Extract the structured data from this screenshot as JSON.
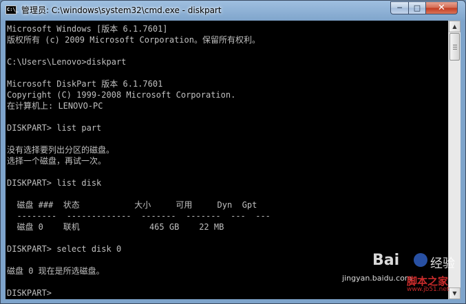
{
  "window": {
    "title": "管理员: C:\\windows\\system32\\cmd.exe - diskpart",
    "app_icon_text": "C:\\_",
    "controls": {
      "minimize": "─",
      "maximize": "□",
      "close": "✕"
    }
  },
  "console": {
    "lines": [
      "Microsoft Windows [版本 6.1.7601]",
      "版权所有 (c) 2009 Microsoft Corporation。保留所有权利。",
      "",
      "C:\\Users\\Lenovo>diskpart",
      "",
      "Microsoft DiskPart 版本 6.1.7601",
      "Copyright (C) 1999-2008 Microsoft Corporation.",
      "在计算机上: LENOVO-PC",
      "",
      "DISKPART> list part",
      "",
      "没有选择要列出分区的磁盘。",
      "选择一个磁盘，再试一次。",
      "",
      "DISKPART> list disk",
      "",
      "  磁盘 ###  状态           大小     可用     Dyn  Gpt",
      "  --------  -------------  -------  -------  ---  ---",
      "  磁盘 0    联机              465 GB    22 MB",
      "",
      "DISKPART> select disk 0",
      "",
      "磁盘 0 现在是所选磁盘。",
      "",
      "DISKPART> "
    ]
  },
  "scrollbar": {
    "up_arrow": "▲",
    "down_arrow": "▼"
  },
  "watermark": {
    "brand": "Bai",
    "brand_cn": "经验",
    "url": "jingyan.baidu.com",
    "logo_cn": "脚本之家",
    "logo_url": "www.jb51.net"
  }
}
